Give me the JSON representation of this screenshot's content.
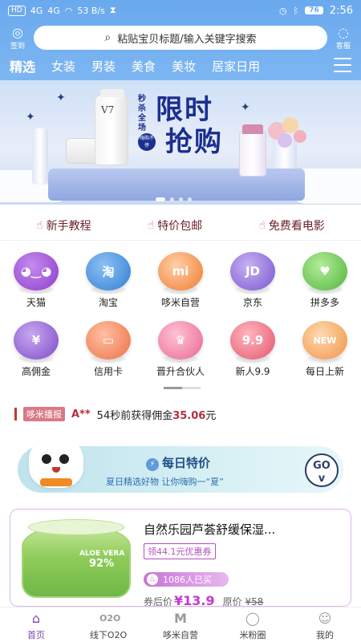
{
  "status_bar": {
    "left_items": [
      "HD",
      "4G",
      "4G",
      "53 B/s"
    ],
    "battery": "76",
    "time": "2:56"
  },
  "header": {
    "signin_label": "签到",
    "service_label": "客服",
    "search_placeholder": "粘贴宝贝标题/输入关键字搜索"
  },
  "category_tabs": [
    {
      "label": "精选",
      "active": true
    },
    {
      "label": "女装",
      "active": false
    },
    {
      "label": "男装",
      "active": false
    },
    {
      "label": "美食",
      "active": false
    },
    {
      "label": "美妆",
      "active": false
    },
    {
      "label": "居家日用",
      "active": false
    }
  ],
  "banner": {
    "seckill": "秒杀全场",
    "headline_1": "限时",
    "headline_2": "抢购",
    "badge": "嗨购不停",
    "product_text": "V7",
    "dots": 4,
    "active_dot": 0
  },
  "quick_links": [
    {
      "label": "新手教程"
    },
    {
      "label": "特价包邮"
    },
    {
      "label": "免费看电影"
    }
  ],
  "grid": [
    {
      "label": "天猫",
      "icon": "tmall-icon",
      "glyph": "◕‿◕",
      "color": "#a64fd6"
    },
    {
      "label": "淘宝",
      "icon": "taobao-icon",
      "glyph": "淘",
      "color": "#3a8bdc"
    },
    {
      "label": "哆米自营",
      "icon": "duomi-icon",
      "glyph": "mi",
      "color": "#f28a3c"
    },
    {
      "label": "京东",
      "icon": "jd-icon",
      "glyph": "JD",
      "color": "#8e6ad8"
    },
    {
      "label": "拼多多",
      "icon": "pinduoduo-icon",
      "glyph": "♥",
      "color": "#62c24a"
    },
    {
      "label": "高佣金",
      "icon": "commission-icon",
      "glyph": "¥",
      "color": "#8c5fd0"
    },
    {
      "label": "信用卡",
      "icon": "credit-card-icon",
      "glyph": "▭",
      "color": "#f0845a"
    },
    {
      "label": "晋升合伙人",
      "icon": "crown-icon",
      "glyph": "♛",
      "color": "#ee7fa6"
    },
    {
      "label": "新人9.9",
      "icon": "newbie-icon",
      "glyph": "9.9",
      "color": "#ec6a7c"
    },
    {
      "label": "每日上新",
      "icon": "new-arrival-icon",
      "glyph": "NEW",
      "color": "#f2a05a"
    }
  ],
  "ticker": {
    "brand": "哆米播报",
    "user": "A**",
    "text": "54秒前获得佣金",
    "amount": "35.06",
    "unit": "元"
  },
  "daily_special": {
    "title": "每日特价",
    "subtitle": "夏日精选好物  让你嗨购一“夏”",
    "go_label": "GO"
  },
  "product": {
    "title": "自然乐园芦荟舒缓保湿...",
    "coupon": "领44.1元优惠券",
    "sold": "1086人已买",
    "price_label": "券后价",
    "price": "¥13.9",
    "orig_label": "原价",
    "orig_price": "¥58",
    "image_text": "ALOE VERA",
    "image_pct": "92%"
  },
  "bottom_nav": [
    {
      "label": "首页",
      "icon": "home-icon",
      "glyph": "⌂",
      "active": true
    },
    {
      "label": "线下O2O",
      "icon": "o2o-icon",
      "glyph": "O2O",
      "active": false
    },
    {
      "label": "哆米自营",
      "icon": "duomi-m-icon",
      "glyph": "M",
      "active": false
    },
    {
      "label": "米粉圈",
      "icon": "magnifier-icon",
      "glyph": "◯",
      "active": false
    },
    {
      "label": "我的",
      "icon": "profile-icon",
      "glyph": "☺",
      "active": false
    }
  ],
  "colors": {
    "accent": "#6aa9ee",
    "price": "#c03ad0",
    "active_nav": "#7a45b8"
  }
}
